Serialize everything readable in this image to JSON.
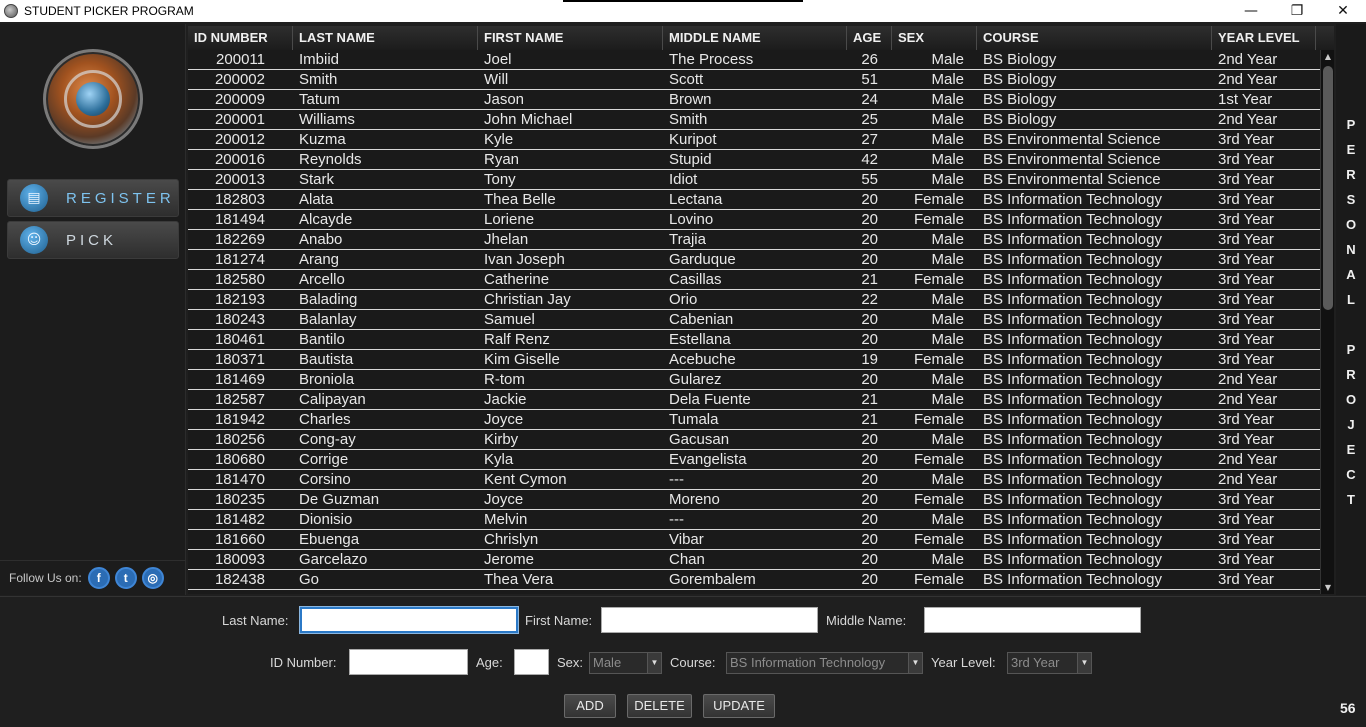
{
  "window": {
    "title": "STUDENT PICKER PROGRAM",
    "minimize": "—",
    "maximize": "❐",
    "close": "✕"
  },
  "sidebar": {
    "register_label": "REGISTER",
    "pick_label": "PICK",
    "follow_label": "Follow Us on:",
    "social": [
      "f",
      "t",
      "◎"
    ]
  },
  "table": {
    "columns": [
      "ID NUMBER",
      "LAST NAME",
      "FIRST NAME",
      "MIDDLE NAME",
      "AGE",
      "SEX",
      "COURSE",
      "YEAR LEVEL"
    ],
    "rows": [
      [
        "200011",
        "Imbiid",
        "Joel",
        "The Process",
        "26",
        "Male",
        "BS Biology",
        "2nd Year"
      ],
      [
        "200002",
        "Smith",
        "Will",
        "Scott",
        "51",
        "Male",
        "BS Biology",
        "2nd Year"
      ],
      [
        "200009",
        "Tatum",
        "Jason",
        "Brown",
        "24",
        "Male",
        "BS Biology",
        "1st Year"
      ],
      [
        "200001",
        "Williams",
        "John Michael",
        "Smith",
        "25",
        "Male",
        "BS Biology",
        "2nd Year"
      ],
      [
        "200012",
        "Kuzma",
        "Kyle",
        "Kuripot",
        "27",
        "Male",
        "BS Environmental Science",
        "3rd Year"
      ],
      [
        "200016",
        "Reynolds",
        "Ryan",
        "Stupid",
        "42",
        "Male",
        "BS Environmental Science",
        "3rd Year"
      ],
      [
        "200013",
        "Stark",
        "Tony",
        "Idiot",
        "55",
        "Male",
        "BS Environmental Science",
        "3rd Year"
      ],
      [
        "182803",
        "Alata",
        "Thea Belle",
        "Lectana",
        "20",
        "Female",
        "BS Information Technology",
        "3rd Year"
      ],
      [
        "181494",
        "Alcayde",
        "Loriene",
        "Lovino",
        "20",
        "Female",
        "BS Information Technology",
        "3rd Year"
      ],
      [
        "182269",
        "Anabo",
        "Jhelan",
        "Trajia",
        "20",
        "Male",
        "BS Information Technology",
        "3rd Year"
      ],
      [
        "181274",
        "Arang",
        "Ivan Joseph",
        "Garduque",
        "20",
        "Male",
        "BS Information Technology",
        "3rd Year"
      ],
      [
        "182580",
        "Arcello",
        "Catherine",
        "Casillas",
        "21",
        "Female",
        "BS Information Technology",
        "3rd Year"
      ],
      [
        "182193",
        "Balading",
        "Christian Jay",
        "Orio",
        "22",
        "Male",
        "BS Information Technology",
        "3rd Year"
      ],
      [
        "180243",
        "Balanlay",
        "Samuel",
        "Cabenian",
        "20",
        "Male",
        "BS Information Technology",
        "3rd Year"
      ],
      [
        "180461",
        "Bantilo",
        "Ralf Renz",
        "Estellana",
        "20",
        "Male",
        "BS Information Technology",
        "3rd Year"
      ],
      [
        "180371",
        "Bautista",
        "Kim Giselle",
        "Acebuche",
        "19",
        "Female",
        "BS Information Technology",
        "3rd Year"
      ],
      [
        "181469",
        "Broniola",
        "R-tom",
        "Gularez",
        "20",
        "Male",
        "BS Information Technology",
        "2nd Year"
      ],
      [
        "182587",
        "Calipayan",
        "Jackie",
        "Dela Fuente",
        "21",
        "Male",
        "BS Information Technology",
        "2nd Year"
      ],
      [
        "181942",
        "Charles",
        "Joyce",
        "Tumala",
        "21",
        "Female",
        "BS Information Technology",
        "3rd Year"
      ],
      [
        "180256",
        "Cong-ay",
        "Kirby",
        "Gacusan",
        "20",
        "Male",
        "BS Information Technology",
        "3rd Year"
      ],
      [
        "180680",
        "Corrige",
        "Kyla",
        "Evangelista",
        "20",
        "Female",
        "BS Information Technology",
        "2nd Year"
      ],
      [
        "181470",
        "Corsino",
        "Kent Cymon",
        "---",
        "20",
        "Male",
        "BS Information Technology",
        "2nd Year"
      ],
      [
        "180235",
        "De Guzman",
        "Joyce",
        "Moreno",
        "20",
        "Female",
        "BS Information Technology",
        "3rd Year"
      ],
      [
        "181482",
        "Dionisio",
        "Melvin",
        "---",
        "20",
        "Male",
        "BS Information Technology",
        "3rd Year"
      ],
      [
        "181660",
        "Ebuenga",
        "Chrislyn",
        "Vibar",
        "20",
        "Female",
        "BS Information Technology",
        "3rd Year"
      ],
      [
        "180093",
        "Garcelazo",
        "Jerome",
        "Chan",
        "20",
        "Male",
        "BS Information Technology",
        "3rd Year"
      ],
      [
        "182438",
        "Go",
        "Thea Vera",
        "Gorembalem",
        "20",
        "Female",
        "BS Information Technology",
        "3rd Year"
      ]
    ]
  },
  "right_panel": {
    "vertical_text": "PERSONAL PROJECT"
  },
  "form": {
    "last_name_label": "Last Name:",
    "first_name_label": "First Name:",
    "middle_name_label": "Middle Name:",
    "id_number_label": "ID Number:",
    "age_label": "Age:",
    "sex_label": "Sex:",
    "sex_value": "Male",
    "course_label": "Course:",
    "course_value": "BS Information Technology",
    "year_level_label": "Year Level:",
    "year_level_value": "3rd Year",
    "add_label": "ADD",
    "delete_label": "DELETE",
    "update_label": "UPDATE"
  },
  "record_count": "56",
  "colors": {
    "accent": "#2b79c7",
    "background": "#1f1f1f",
    "register_text": "#7ec3ef"
  }
}
